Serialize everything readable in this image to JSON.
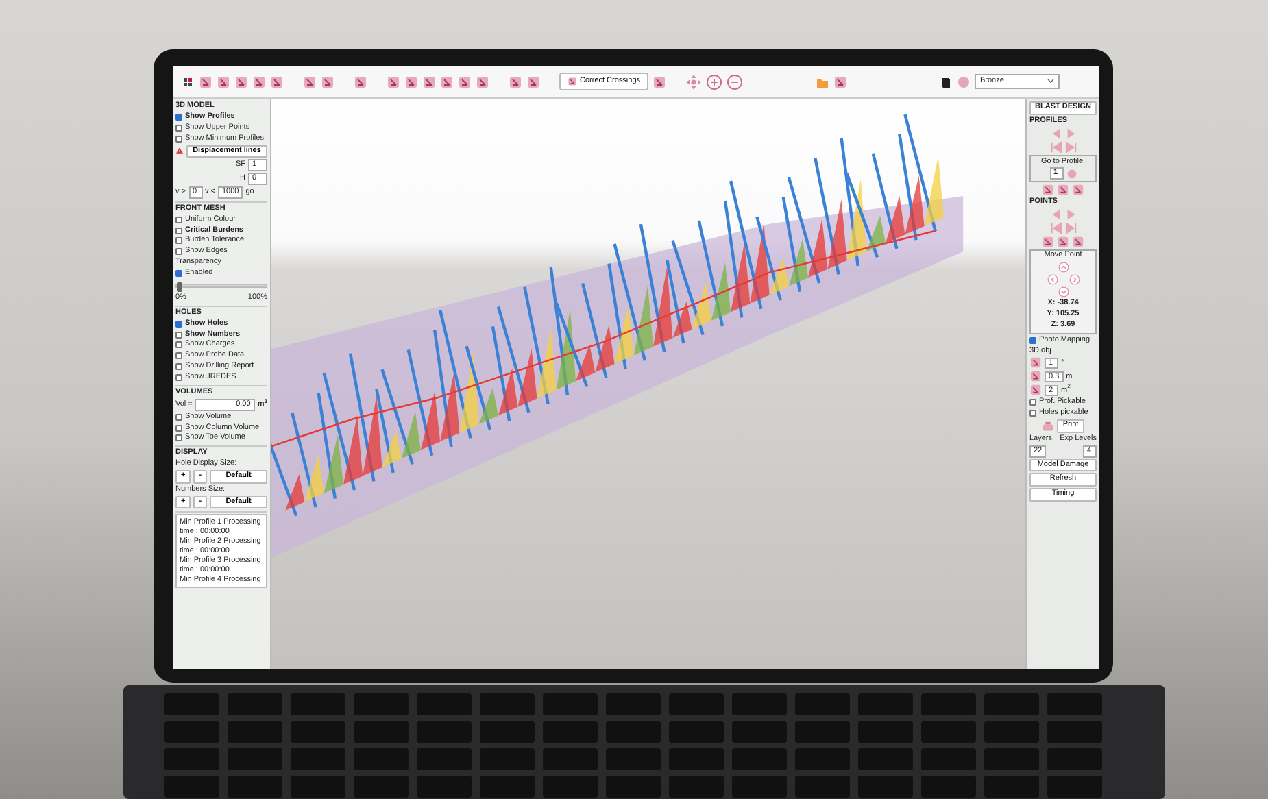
{
  "toolbar": {
    "correct_crossings_button": "Correct Crossings",
    "material_select": {
      "value": "Bronze"
    }
  },
  "left_panel": {
    "sections": [
      {
        "title": "3D MODEL",
        "items": [
          {
            "kind": "check",
            "label": "Show Profiles",
            "checked": true,
            "bold": true
          },
          {
            "kind": "check",
            "label": "Show Upper Points",
            "checked": false,
            "bold": false
          },
          {
            "kind": "check",
            "label": "Show Minimum Profiles",
            "checked": false,
            "bold": false
          },
          {
            "kind": "warning_button",
            "label": "Displacement lines"
          },
          {
            "kind": "field",
            "label": "SF",
            "value": "1"
          },
          {
            "kind": "field",
            "label": "H",
            "value": "0"
          },
          {
            "kind": "range",
            "min_label": "v >",
            "min_value": "0",
            "max_label": "v <",
            "max_value": "1000",
            "go": "go"
          }
        ]
      },
      {
        "title": "FRONT MESH",
        "items": [
          {
            "kind": "check",
            "label": "Uniform Colour",
            "checked": false,
            "bold": false
          },
          {
            "kind": "check",
            "label": "Critical Burdens",
            "checked": false,
            "bold": true
          },
          {
            "kind": "check",
            "label": "Burden Tolerance",
            "checked": false,
            "bold": false
          },
          {
            "kind": "check",
            "label": "Show Edges",
            "checked": false,
            "bold": false
          },
          {
            "kind": "label",
            "text": "Transparency"
          },
          {
            "kind": "check",
            "label": "Enabled",
            "checked": true,
            "bold": false
          },
          {
            "kind": "slider",
            "level": 0,
            "min": "0%",
            "max": "100%"
          }
        ]
      },
      {
        "title": "HOLES",
        "items": [
          {
            "kind": "check",
            "label": "Show Holes",
            "checked": true,
            "bold": true
          },
          {
            "kind": "check",
            "label": "Show Numbers",
            "checked": false,
            "bold": true
          },
          {
            "kind": "check",
            "label": "Show Charges",
            "checked": false,
            "bold": false
          },
          {
            "kind": "check",
            "label": "Show Probe Data",
            "checked": false,
            "bold": false
          },
          {
            "kind": "check",
            "label": "Show Drilling Report",
            "checked": false,
            "bold": false
          },
          {
            "kind": "check",
            "label": "Show .IREDES",
            "checked": false,
            "bold": false
          }
        ]
      },
      {
        "title": "VOLUMES",
        "items": [
          {
            "kind": "value_field",
            "label": "Vol =",
            "value": "0.00",
            "unit": "m$^{3}$"
          },
          {
            "kind": "check",
            "label": "Show Volume",
            "checked": false,
            "bold": false
          },
          {
            "kind": "check",
            "label": "Show Column Volume",
            "checked": false,
            "bold": false
          },
          {
            "kind": "check",
            "label": "Show Toe Volume",
            "checked": false,
            "bold": false
          }
        ]
      },
      {
        "title": "DISPLAY",
        "items": [
          {
            "kind": "label",
            "text": "Hole Display Size:"
          },
          {
            "kind": "buttons",
            "buttons": [
              "+",
              "-",
              "Default"
            ]
          },
          {
            "kind": "label",
            "text": "Numbers Size:"
          },
          {
            "kind": "buttons",
            "buttons": [
              "+",
              "-",
              "Default"
            ]
          }
        ]
      }
    ],
    "log": [
      "Min Profile 1 Processing",
      "time : 00:00:00",
      "Min Profile 2 Processing",
      "time : 00:00:00",
      "Min Profile 3 Processing",
      "time : 00:00:00",
      "Min Profile 4 Processing"
    ]
  },
  "right_panel": {
    "title": "BLAST DESIGN",
    "items": [
      {
        "kind": "heading",
        "text": "PROFILES"
      },
      {
        "kind": "nav"
      },
      {
        "kind": "goto",
        "label": "Go to Profile:",
        "value": "1"
      },
      {
        "kind": "icons"
      },
      {
        "kind": "heading",
        "text": "POINTS"
      },
      {
        "kind": "nav"
      },
      {
        "kind": "icons"
      },
      {
        "kind": "move_point",
        "title": "Move Point",
        "coords": [
          "X: -38.74",
          "Y: 105.25",
          "Z: 3.69"
        ]
      },
      {
        "kind": "check",
        "label": "Photo Mapping",
        "checked": true,
        "bold": false
      },
      {
        "kind": "label",
        "text": "3D.obj"
      },
      {
        "kind": "param",
        "value": "1",
        "unit": "°"
      },
      {
        "kind": "param",
        "value": "0.3",
        "unit": "m"
      },
      {
        "kind": "param",
        "value": "2",
        "unit": "m$^{2}$"
      },
      {
        "kind": "check",
        "label": "Prof. Pickable",
        "checked": false,
        "bold": false
      },
      {
        "kind": "check",
        "label": "Holes pickable",
        "checked": false,
        "bold": false
      },
      {
        "kind": "print",
        "label": "Print"
      },
      {
        "kind": "layers",
        "labels": [
          "Layers",
          "Exp Levels"
        ],
        "values": [
          "22",
          "4"
        ]
      },
      {
        "kind": "button",
        "label": "Model Damage"
      },
      {
        "kind": "button",
        "label": "Refresh"
      },
      {
        "kind": "button",
        "label": "Timing"
      }
    ]
  }
}
